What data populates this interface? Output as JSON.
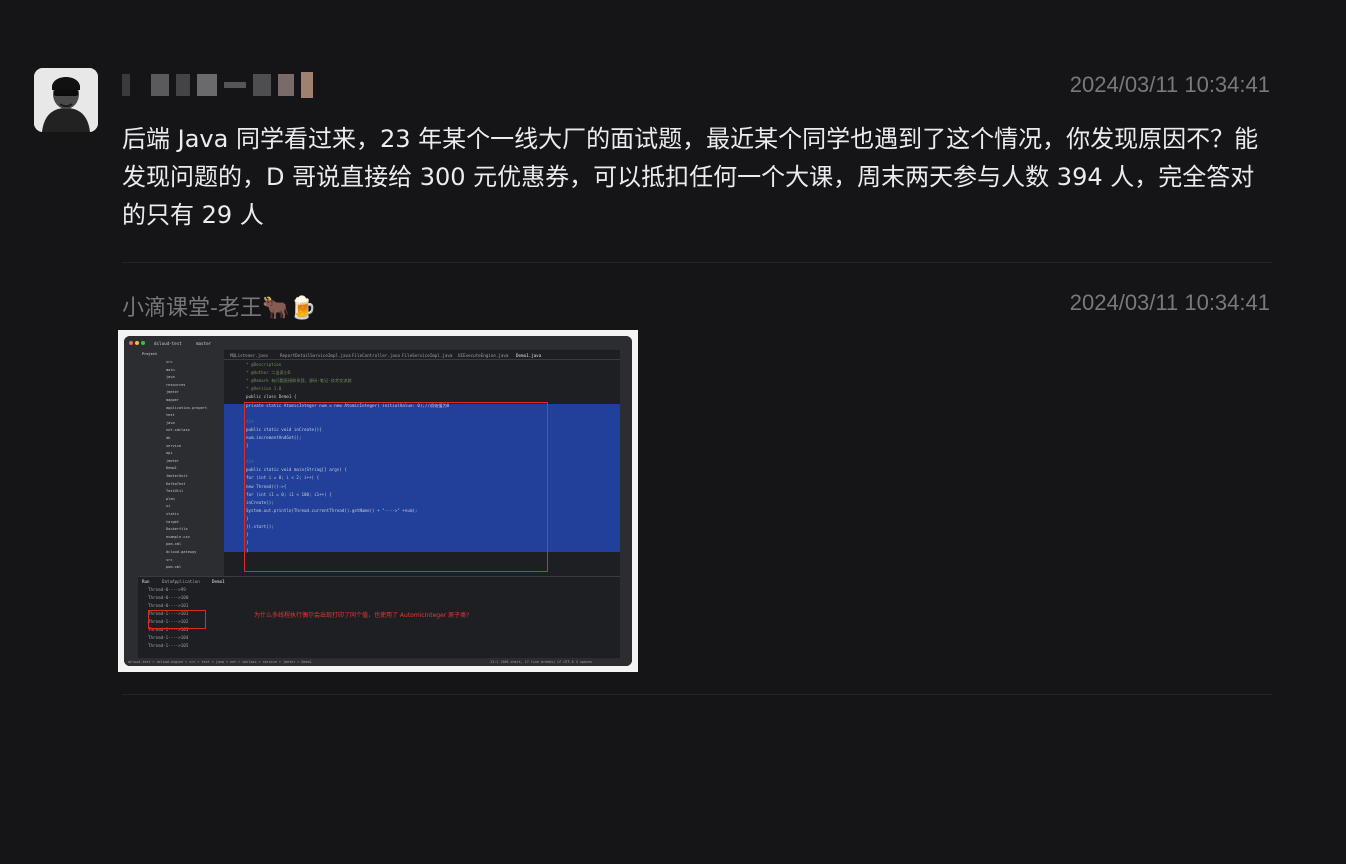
{
  "messages": [
    {
      "sender": "",
      "time": "2024/03/11 10:34:41",
      "text": "后端 Java 同学看过来，23 年某个一线大厂的面试题，最近某个同学也遇到了这个情况，你发现原因不？能发现问题的，D 哥说直接给 300 元优惠券，可以抵扣任何一个大课，周末两天参与人数 394 人，完全答对的只有 29 人"
    },
    {
      "sender": "小滴课堂-老王🐂🍺",
      "time": "2024/03/11 10:34:41"
    }
  ],
  "screenshot": {
    "branch": "master",
    "project_name": "dcloud-test",
    "tabs": [
      "MQListener.java",
      "ReportDetailServiceImpl.java",
      "FileController.java",
      "FileServiceImpl.java",
      "UIExecuteEngine.java",
      "Demo1.java"
    ],
    "code_lines": [
      "* @Description",
      "* @Author 二当家小D",
      "* @Remark 有问题直接联系我，源码-笔记-技术交流群",
      "* @Version 1.0",
      "public class Demo1 {",
      "    private static AtomicInteger num = new AtomicInteger( initialValue: 0);//初始值为0",
      "",
      "    //+",
      "    public static void inCreate(){",
      "        num.incrementAndGet();",
      "    }",
      "",
      "    //+",
      "    public static void main(String[] args) {",
      "        for (int i = 0; i < 2; i++) {",
      "            new Thread(()->{",
      "                for (int i1 = 0; i1 < 100; i1++) {",
      "                    inCreate();",
      "                    System.out.println(Thread.currentThread().getName() + \"---->\" +num);",
      "                }",
      "            }).start();",
      "        }",
      "    }",
      "}"
    ],
    "run_tabs": [
      "Run",
      "DataApplication",
      "Demo1"
    ],
    "console_lines": [
      "Thread-0---->99",
      "Thread-0---->100",
      "Thread-0---->101",
      "Thread-1---->101",
      "Thread-1---->102",
      "Thread-1---->103",
      "Thread-1---->104",
      "Thread-1---->105"
    ],
    "question": "为什么多线程执行偶尔会出现打印了同个值，也使用了 AutomicInteger 原子类?",
    "tree_items": [
      "src",
      "main",
      "java",
      "resources",
      "jmeter",
      "mapper",
      "application.propert",
      "test",
      "java",
      "net.xdclass",
      "db",
      "service",
      "api",
      "jmeter",
      "Demo1",
      "JmeterUnit",
      "KafkaTest",
      "TestUtil",
      "plan",
      "ui",
      "static",
      "target",
      "Dockerfile",
      "example.csv",
      "pom.xml",
      "dcloud-gateway",
      "src",
      "pom.xml"
    ],
    "breadcrumb": "dcloud-test > dcloud-engine > src > test > java > net > xdclass > service > jmeter > Demo1",
    "status_right": "13:1 (508 chars, 17 line breaks)  LF  UTF-8  4 spaces"
  }
}
